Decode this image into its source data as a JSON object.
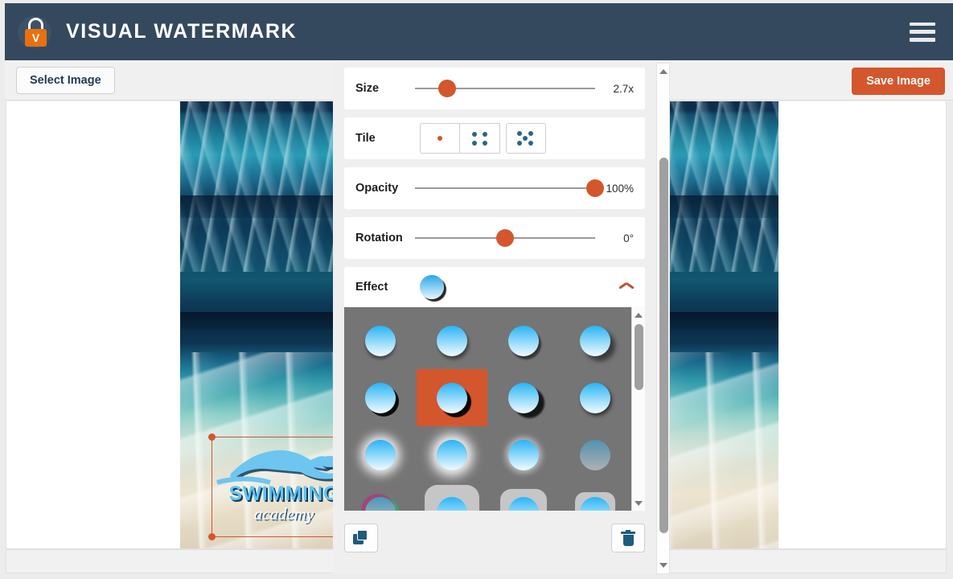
{
  "header": {
    "brand": "VISUAL WATERMARK",
    "logo_icon": "padlock-v-icon",
    "logo_letter": "V",
    "menu_icon": "hamburger-menu-icon",
    "bg_color": "#34495e"
  },
  "toolbar": {
    "select_image_label": "Select Image",
    "save_image_label": "Save Image",
    "save_color": "#d4562c"
  },
  "canvas": {
    "photo_description": "underwater-pool-photo",
    "watermark": {
      "title": "SWIMMING",
      "subtitle": "academy",
      "logo_icon": "swimmer-icon",
      "selected": true,
      "handle_color": "#d4562c"
    }
  },
  "panel": {
    "rows": [
      {
        "label": "Size",
        "value": "2.7x",
        "slider_pct": 18
      },
      {
        "label": "Tile",
        "value": "",
        "slider_pct": 0
      },
      {
        "label": "Opacity",
        "value": "100%",
        "slider_pct": 100
      },
      {
        "label": "Rotation",
        "value": "0°",
        "slider_pct": 50
      }
    ],
    "tile": {
      "label": "Tile",
      "options": [
        {
          "icon": "single-dot-icon",
          "selected": true
        },
        {
          "icon": "four-dot-grid-icon",
          "selected": false
        },
        {
          "icon": "five-dot-diamond-icon",
          "selected": false
        }
      ]
    },
    "effect": {
      "label": "Effect",
      "preview_icon": "drop-shadow-circle-icon",
      "collapse_icon": "chevron-up-icon",
      "expanded": true,
      "grid_bg": "#757575",
      "selected_index": 5,
      "selected_color": "#d4562c",
      "items": [
        {
          "name": "shadow-soft-bottom"
        },
        {
          "name": "shadow-soft-offset"
        },
        {
          "name": "shadow-hard-offset"
        },
        {
          "name": "shadow-blur-large"
        },
        {
          "name": "shadow-hard-solid"
        },
        {
          "name": "shadow-hard-solid-selected"
        },
        {
          "name": "shadow-hard-right"
        },
        {
          "name": "shadow-blur-medium"
        },
        {
          "name": "glow-white-soft"
        },
        {
          "name": "glow-white-strong"
        },
        {
          "name": "glow-white-faint"
        },
        {
          "name": "fade-translucent"
        },
        {
          "name": "chromatic-edge"
        },
        {
          "name": "frame-rounded-thick"
        },
        {
          "name": "frame-rounded-medium"
        },
        {
          "name": "frame-rounded-thin"
        }
      ]
    },
    "actions": {
      "duplicate_icon": "copy-icon",
      "delete_icon": "trash-icon"
    },
    "scrollbars": {
      "inner_up_icon": "triangle-up-icon",
      "inner_down_icon": "triangle-down-icon",
      "outer_up_icon": "triangle-up-icon",
      "outer_down_icon": "triangle-down-icon"
    }
  }
}
